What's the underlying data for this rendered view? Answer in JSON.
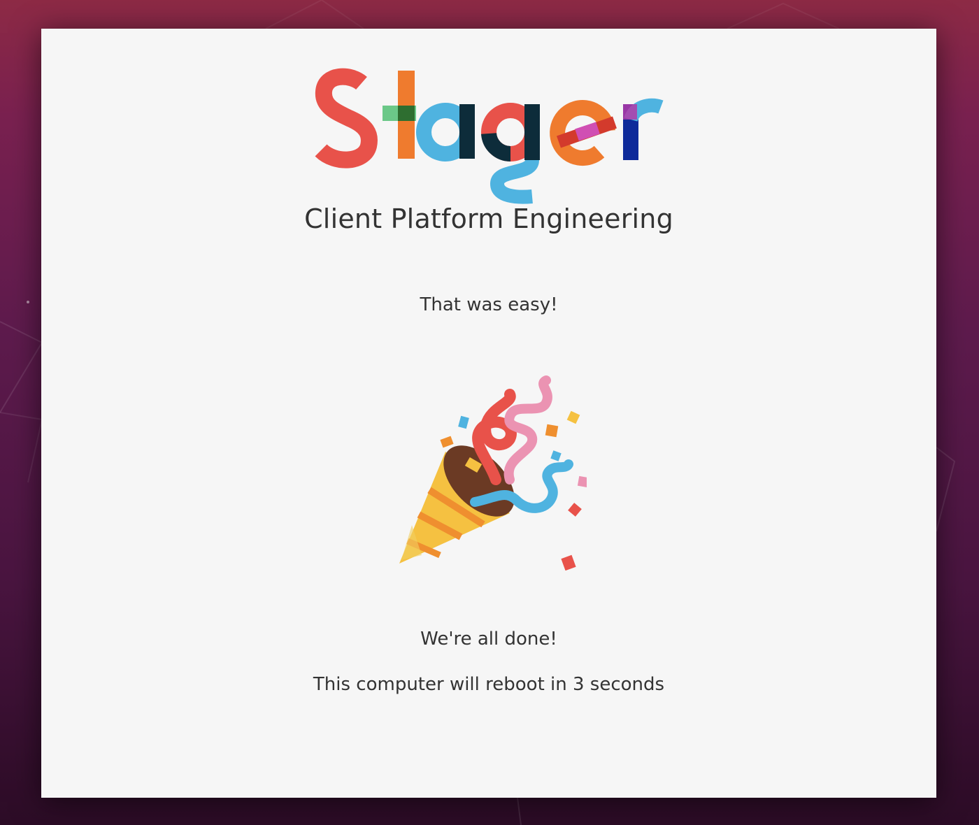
{
  "brand": {
    "logo_text": "Stager",
    "subtitle": "Client Platform Engineering"
  },
  "messages": {
    "success_title": "That was easy!",
    "done": "We're all done!",
    "reboot_notice": "This computer will reboot in 3 seconds"
  },
  "icons": {
    "celebration": "party-popper-icon"
  },
  "colors": {
    "dialog_bg": "#f6f6f6",
    "text": "#333333",
    "logo_red": "#e8524a",
    "logo_orange": "#ef7b2e",
    "logo_blue": "#4fb3e0",
    "logo_navy": "#0d2c3a",
    "logo_green": "#5cc37c",
    "logo_pink": "#d04fb3",
    "logo_darkblue": "#0e2a9a"
  }
}
